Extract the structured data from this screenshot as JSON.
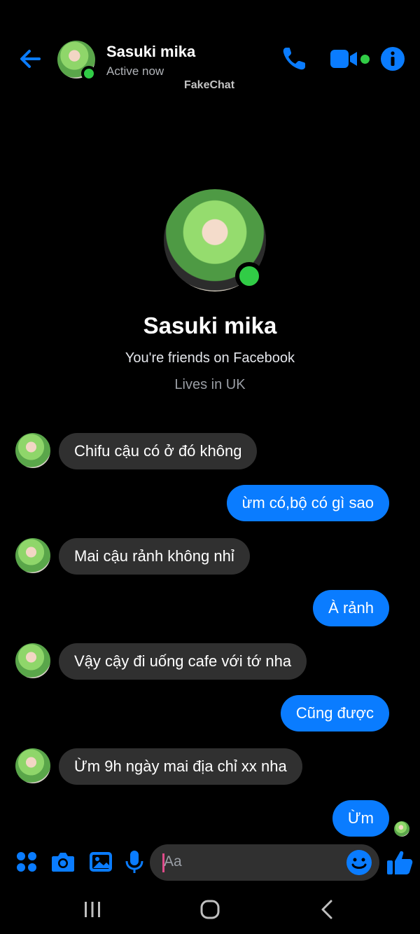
{
  "header": {
    "name": "Sasuki mika",
    "status": "Active now",
    "watermark": "FakeChat",
    "icons": [
      "back-arrow-icon",
      "phone-icon",
      "video-camera-icon",
      "info-icon"
    ]
  },
  "profile": {
    "name": "Sasuki mika",
    "friends_text": "You're friends on Facebook",
    "lives_text": "Lives in UK"
  },
  "messages": [
    {
      "from": "them",
      "text": "Chifu cậu có ở đó không"
    },
    {
      "from": "me",
      "text": "ừm có,bộ có gì sao"
    },
    {
      "from": "them",
      "text": "Mai cậu rảnh không nhỉ"
    },
    {
      "from": "me",
      "text": "À rảnh"
    },
    {
      "from": "them",
      "text": "Vậy cậy đi uống cafe với tớ nha"
    },
    {
      "from": "me",
      "text": "Cũng được"
    },
    {
      "from": "them",
      "text": "Ừm 9h ngày mai địa chỉ xx nha"
    },
    {
      "from": "me",
      "text": "Ừm"
    }
  ],
  "composer": {
    "placeholder": "Aa",
    "icons": [
      "apps-icon",
      "camera-icon",
      "gallery-icon",
      "microphone-icon",
      "emoji-icon",
      "thumbs-up-icon"
    ]
  },
  "system_nav": {
    "icons": [
      "recent-apps-icon",
      "home-icon",
      "back-icon"
    ]
  },
  "colors": {
    "background": "#000000",
    "accent": "#0a7cff",
    "incoming_bubble": "#303030",
    "online": "#31cc46"
  }
}
